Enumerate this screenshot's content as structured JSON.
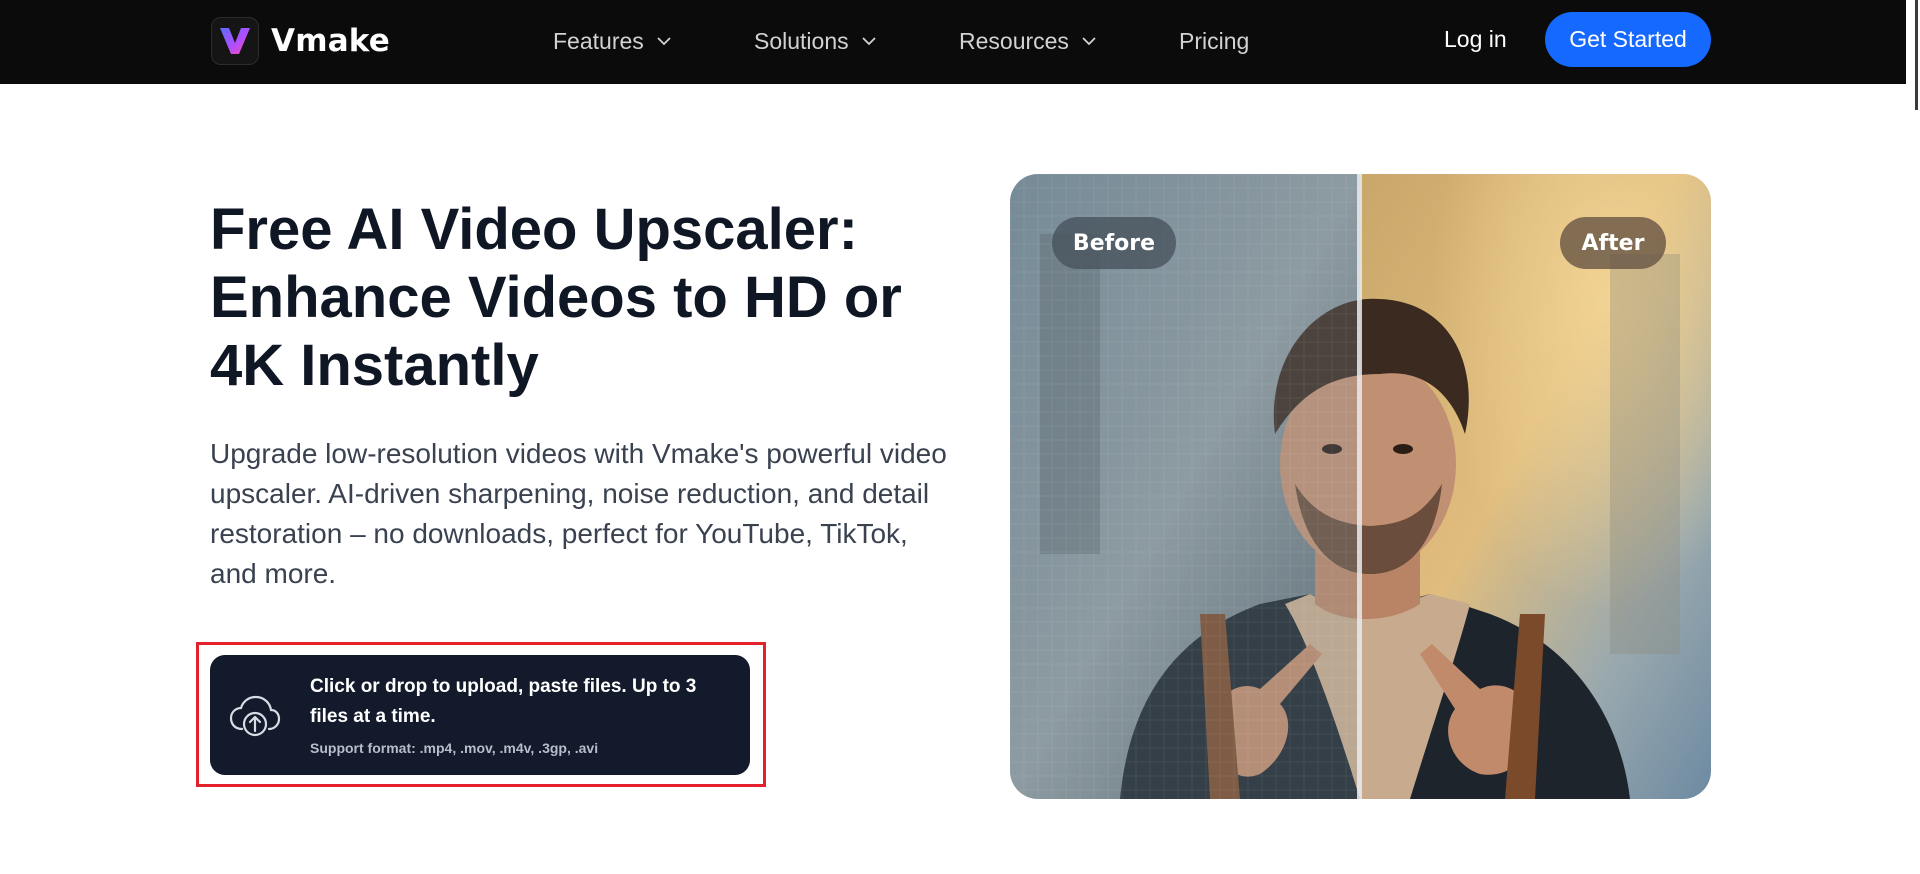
{
  "nav": {
    "logo_text": "Vmake",
    "features": "Features",
    "solutions": "Solutions",
    "resources": "Resources",
    "pricing": "Pricing",
    "login": "Log in",
    "get_started": "Get Started"
  },
  "hero": {
    "title": "Free AI Video Upscaler: Enhance Videos to HD or 4K Instantly",
    "description": "Upgrade low-resolution videos with Vmake's powerful video upscaler. AI-driven sharpening, noise reduction, and detail restoration – no downloads, perfect for YouTube, TikTok, and more."
  },
  "upload": {
    "main": "Click or drop to upload, paste files. Up to 3 files at a time.",
    "formats": "Support format: .mp4, .mov, .m4v, .3gp, .avi",
    "icon": "cloud-upload-icon"
  },
  "compare": {
    "before_label": "Before",
    "after_label": "After"
  },
  "colors": {
    "nav_bg": "#0b0b0b",
    "accent": "#1669ff",
    "upload_bg": "#121a2b",
    "highlight": "#e4202b"
  }
}
